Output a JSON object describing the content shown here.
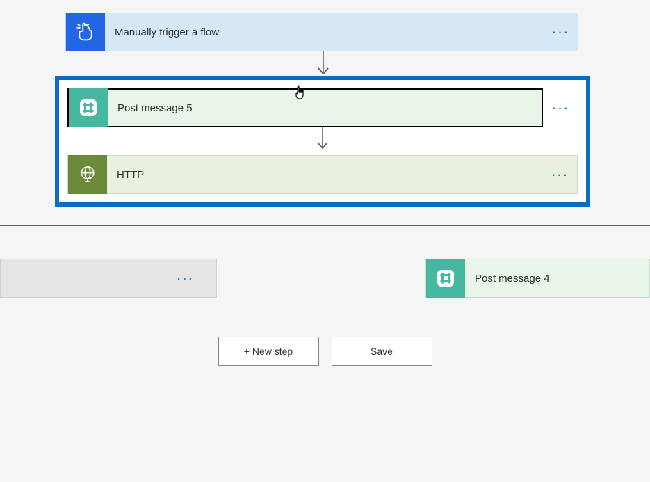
{
  "trigger": {
    "label": "Manually trigger a flow"
  },
  "selected_group": {
    "post5": {
      "label": "Post message 5"
    },
    "http": {
      "label": "HTTP"
    }
  },
  "branches": {
    "right": {
      "label": "Post message 4"
    }
  },
  "buttons": {
    "new_step": "+ New step",
    "save": "Save"
  },
  "menu_glyph": "···"
}
